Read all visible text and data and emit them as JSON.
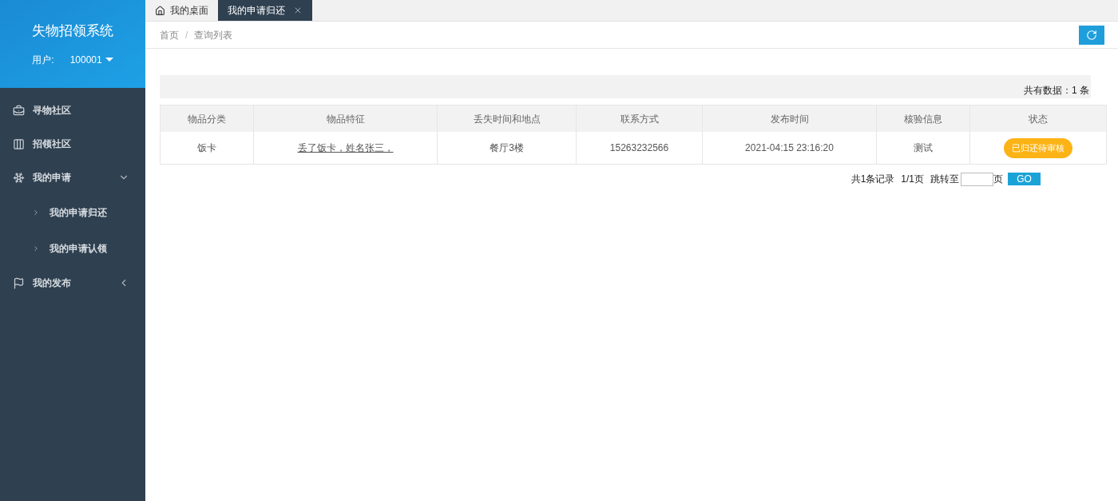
{
  "sidebar": {
    "title": "失物招领系统",
    "user_label": "用户:",
    "user_name": "100001",
    "items": [
      {
        "label": "寻物社区"
      },
      {
        "label": "招领社区"
      },
      {
        "label": "我的申请",
        "expanded": true,
        "children": [
          {
            "label": "我的申请归还"
          },
          {
            "label": "我的申请认领"
          }
        ]
      },
      {
        "label": "我的发布",
        "expanded": false
      }
    ]
  },
  "tabs": [
    {
      "label": "我的桌面",
      "selected": false,
      "closable": false
    },
    {
      "label": "我的申请归还",
      "selected": true,
      "closable": true
    }
  ],
  "breadcrumb": [
    "首页",
    "查询列表"
  ],
  "breadcrumb_separator": "/",
  "total": "共有数据：1 条",
  "table": {
    "columns": [
      "物品分类",
      "物品特征",
      "丢失时间和地点",
      "联系方式",
      "发布时间",
      "核验信息",
      "状态"
    ],
    "rows": [
      {
        "category": "饭卡",
        "feature": "丢了饭卡，姓名张三，",
        "place": "餐厅3楼",
        "contact": "15263232566",
        "time": "2021-04:15 23:16:20",
        "check": "测试",
        "status": "已归还待审核"
      }
    ]
  },
  "pagination": {
    "records": "共1条记录",
    "pages": "1/1页",
    "jump": "跳转至",
    "unit": "页",
    "go": "GO"
  }
}
